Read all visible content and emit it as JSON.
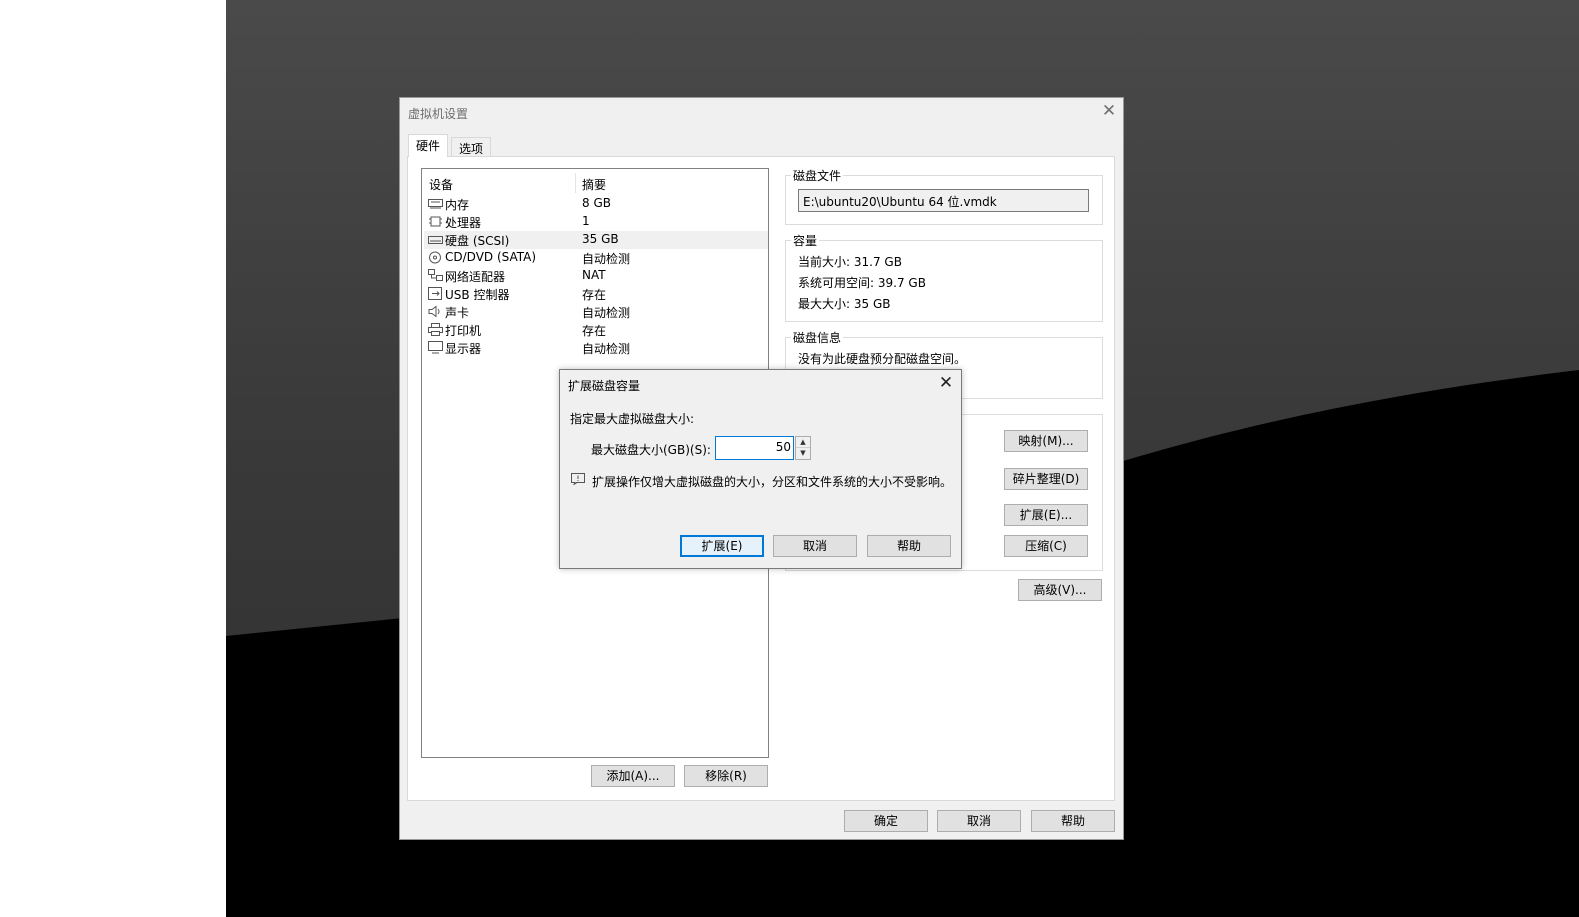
{
  "main_dialog": {
    "title": "虚拟机设置",
    "close_glyph": "✕",
    "tabs": [
      {
        "label": "硬件",
        "active": true
      },
      {
        "label": "选项",
        "active": false
      }
    ],
    "device_list": {
      "headers": {
        "device": "设备",
        "summary": "摘要"
      },
      "rows": [
        {
          "icon": "memory-icon",
          "name": "内存",
          "summary": "8 GB",
          "selected": false
        },
        {
          "icon": "processor-icon",
          "name": "处理器",
          "summary": "1",
          "selected": false
        },
        {
          "icon": "hard-disk-icon",
          "name": "硬盘 (SCSI)",
          "summary": "35 GB",
          "selected": true
        },
        {
          "icon": "cd-dvd-icon",
          "name": "CD/DVD (SATA)",
          "summary": "自动检测",
          "selected": false
        },
        {
          "icon": "network-adapter-icon",
          "name": "网络适配器",
          "summary": "NAT",
          "selected": false
        },
        {
          "icon": "usb-icon",
          "name": "USB 控制器",
          "summary": "存在",
          "selected": false
        },
        {
          "icon": "sound-card-icon",
          "name": "声卡",
          "summary": "自动检测",
          "selected": false
        },
        {
          "icon": "printer-icon",
          "name": "打印机",
          "summary": "存在",
          "selected": false
        },
        {
          "icon": "display-icon",
          "name": "显示器",
          "summary": "自动检测",
          "selected": false
        }
      ]
    },
    "list_buttons": {
      "add": "添加(A)...",
      "remove": "移除(R)"
    },
    "disk_file": {
      "title": "磁盘文件",
      "value": "E:\\ubuntu20\\Ubuntu 64 位.vmdk"
    },
    "capacity": {
      "title": "容量",
      "current_size": "当前大小: 31.7 GB",
      "system_free": "系统可用空间: 39.7 GB",
      "max_size": "最大大小: 35 GB"
    },
    "disk_info": {
      "title": "磁盘信息",
      "text": "没有为此硬盘预分配磁盘空间。"
    },
    "utility_buttons": {
      "map": "映射(M)...",
      "defragment": "碎片整理(D)",
      "expand": "扩展(E)...",
      "compact": "压缩(C)",
      "advanced": "高级(V)..."
    },
    "footer_buttons": {
      "ok": "确定",
      "cancel": "取消",
      "help": "帮助"
    }
  },
  "expand_dialog": {
    "title": "扩展磁盘容量",
    "close_glyph": "✕",
    "instruction": "指定最大虚拟磁盘大小:",
    "size_label": "最大磁盘大小(GB)(S):",
    "size_value": "50",
    "spin_up": "▲",
    "spin_down": "▼",
    "info_text": "扩展操作仅增大虚拟磁盘的大小，分区和文件系统的大小不受影响。",
    "buttons": {
      "expand": "扩展(E)",
      "cancel": "取消",
      "help": "帮助"
    }
  },
  "colors": {
    "accent": "#0078d7",
    "dialog_bg": "#f0f0f0",
    "desktop_dark": "#000000"
  }
}
